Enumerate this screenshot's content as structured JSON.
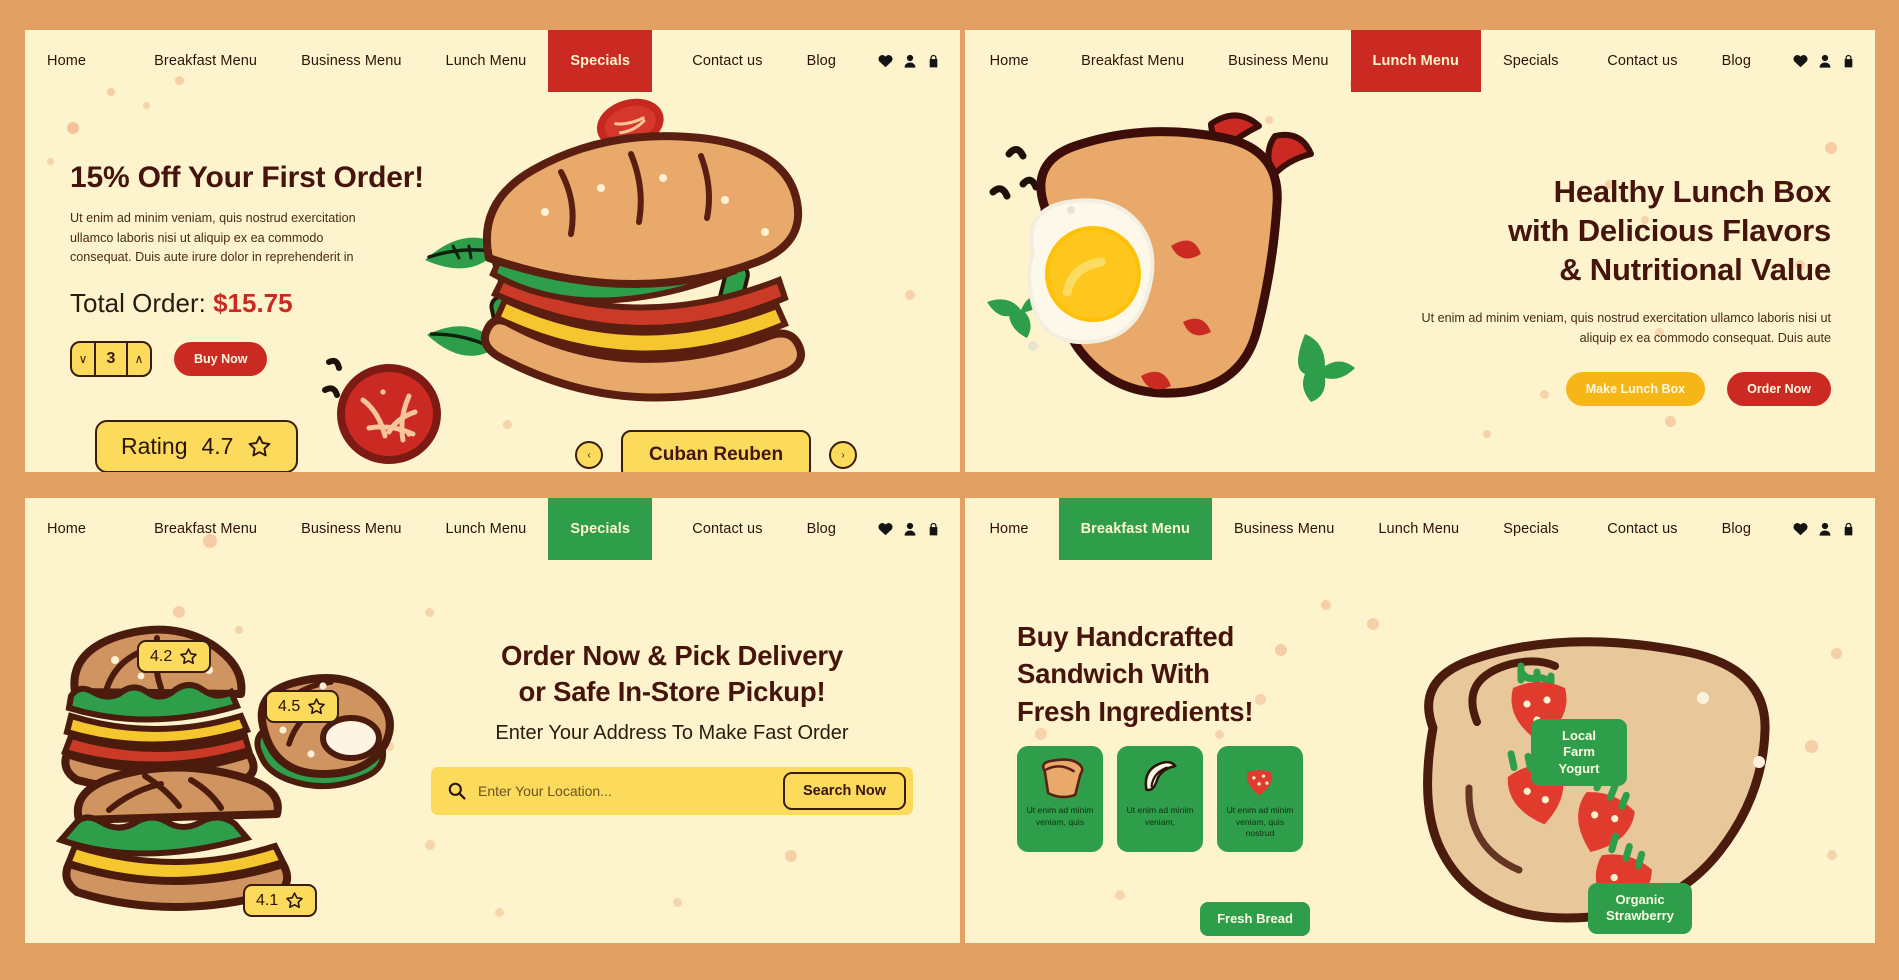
{
  "theme": {
    "page_bg": "#e2a163",
    "panel_bg": "#fdf4cd",
    "red": "#cb2a22",
    "green": "#2e9e4b",
    "yellow": "#fbda5c",
    "orange": "#f7b618",
    "dark_text": "#45140c"
  },
  "nav_icons": [
    "heart-icon",
    "user-icon",
    "bag-icon"
  ],
  "panels": {
    "top_left": {
      "nav": {
        "items": [
          {
            "label": "Home",
            "active": false
          },
          {
            "label": "Breakfast Menu",
            "active": false
          },
          {
            "label": "Business Menu",
            "active": false
          },
          {
            "label": "Lunch Menu",
            "active": false
          },
          {
            "label": "Specials",
            "active": true,
            "accent": "red"
          },
          {
            "label": "Contact us",
            "active": false
          },
          {
            "label": "Blog",
            "active": false
          }
        ]
      },
      "heading": "15% Off Your First Order!",
      "body": "Ut enim ad minim veniam, quis nostrud exercitation ullamco laboris nisi ut aliquip ex ea commodo consequat. Duis aute irure dolor in reprehenderit in",
      "total_label": "Total Order:",
      "total_value": "$15.75",
      "quantity": "3",
      "stepper_down": "∨",
      "stepper_up": "∧",
      "buy_button": "Buy Now",
      "rating_label": "Rating",
      "rating_value": "4.7",
      "prev_arrow": "‹",
      "next_arrow": "›",
      "product_name": "Cuban Reuben"
    },
    "top_right": {
      "nav": {
        "items": [
          {
            "label": "Home",
            "active": false
          },
          {
            "label": "Breakfast Menu",
            "active": false
          },
          {
            "label": "Business Menu",
            "active": false
          },
          {
            "label": "Lunch Menu",
            "active": true,
            "accent": "red"
          },
          {
            "label": "Specials",
            "active": false
          },
          {
            "label": "Contact us",
            "active": false
          },
          {
            "label": "Blog",
            "active": false
          }
        ]
      },
      "heading_line1": "Healthy Lunch Box",
      "heading_line2": "with Delicious Flavors",
      "heading_line3": "& Nutritional Value",
      "body": "Ut enim ad minim veniam, quis nostrud exercitation ullamco laboris nisi ut aliquip ex ea commodo consequat. Duis aute",
      "primary_button": "Make Lunch Box",
      "secondary_button": "Order Now"
    },
    "bottom_left": {
      "nav": {
        "items": [
          {
            "label": "Home",
            "active": false
          },
          {
            "label": "Breakfast Menu",
            "active": false
          },
          {
            "label": "Business Menu",
            "active": false
          },
          {
            "label": "Lunch Menu",
            "active": false
          },
          {
            "label": "Specials",
            "active": true,
            "accent": "green"
          },
          {
            "label": "Contact us",
            "active": false
          },
          {
            "label": "Blog",
            "active": false
          }
        ]
      },
      "heading_line1": "Order Now & Pick Delivery",
      "heading_line2": "or Safe In-Store Pickup!",
      "subheading": "Enter Your Address To Make Fast Order",
      "search_placeholder": "Enter Your Location...",
      "search_value": "",
      "search_button": "Search Now",
      "ratings": [
        {
          "value": "4.2",
          "item": "burger"
        },
        {
          "value": "4.5",
          "item": "bagel"
        },
        {
          "value": "4.1",
          "item": "grilled-sandwich"
        }
      ]
    },
    "bottom_right": {
      "nav": {
        "items": [
          {
            "label": "Home",
            "active": false
          },
          {
            "label": "Breakfast Menu",
            "active": true,
            "accent": "green"
          },
          {
            "label": "Business Menu",
            "active": false
          },
          {
            "label": "Lunch Menu",
            "active": false
          },
          {
            "label": "Specials",
            "active": false
          },
          {
            "label": "Contact us",
            "active": false
          },
          {
            "label": "Blog",
            "active": false
          }
        ]
      },
      "heading_line1": "Buy Handcrafted",
      "heading_line2": "Sandwich  With",
      "heading_line3": "Fresh Ingredients!",
      "feature_cards": [
        {
          "icon": "bread-slice-icon",
          "text": "Ut enim ad minim veniam, quis"
        },
        {
          "icon": "banana-icon",
          "text": "Ut enim ad minim veniam,"
        },
        {
          "icon": "strawberry-icon",
          "text": "Ut enim ad minim veniam, quis nostrud"
        }
      ],
      "tags": [
        {
          "label": "Local Farm Yogurt"
        },
        {
          "label": "Fresh Bread"
        },
        {
          "label": "Organic Strawberry"
        }
      ]
    }
  }
}
